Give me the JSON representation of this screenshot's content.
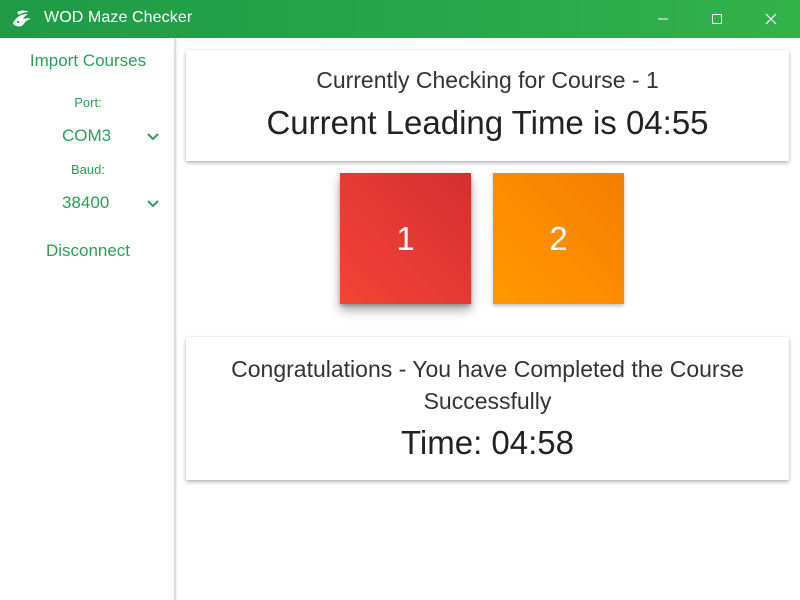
{
  "window": {
    "title": "WOD Maze Checker",
    "icons": {
      "app": "dragon-logo-icon",
      "minimize": "minimize-icon",
      "maximize": "maximize-icon",
      "close": "close-icon"
    }
  },
  "sidebar": {
    "import_label": "Import Courses",
    "port_label": "Port:",
    "port_value": "COM3",
    "baud_label": "Baud:",
    "baud_value": "38400",
    "disconnect_label": "Disconnect"
  },
  "status": {
    "checking_text": "Currently Checking for Course - 1",
    "leading_text": "Current Leading Time is 04:55"
  },
  "tiles": [
    {
      "label": "1",
      "color": "#e53935"
    },
    {
      "label": "2",
      "color": "#fb8c00"
    }
  ],
  "result": {
    "message": "Congratulations - You have Completed the Course Successfully",
    "time_text": "Time: 04:58"
  },
  "colors": {
    "accent": "#27a152",
    "titlebar": "#25a64a"
  }
}
